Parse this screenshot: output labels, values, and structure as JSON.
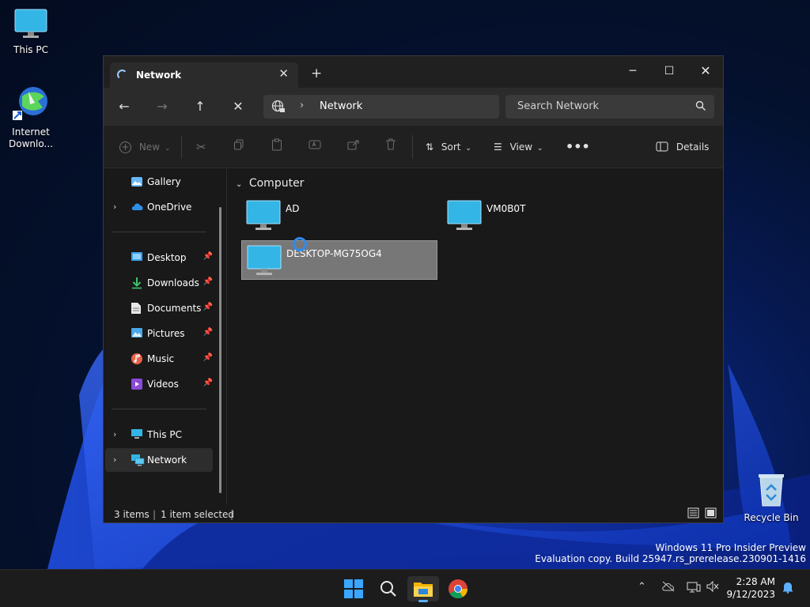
{
  "desktop": {
    "icons": [
      {
        "label": "This PC"
      },
      {
        "label_line1": "Internet",
        "label_line2": "Downlo..."
      },
      {
        "label": "Recycle Bin"
      }
    ]
  },
  "window": {
    "tab_title": "Network",
    "address": {
      "location": "Network"
    },
    "search": {
      "placeholder": "Search Network"
    },
    "toolbar": {
      "new_label": "New",
      "sort_label": "Sort",
      "view_label": "View",
      "details_label": "Details"
    },
    "sidebar": {
      "items": [
        {
          "label": "Gallery"
        },
        {
          "label": "OneDrive"
        },
        {
          "label": "Desktop"
        },
        {
          "label": "Downloads"
        },
        {
          "label": "Documents"
        },
        {
          "label": "Pictures"
        },
        {
          "label": "Music"
        },
        {
          "label": "Videos"
        },
        {
          "label": "This PC"
        },
        {
          "label": "Network"
        }
      ]
    },
    "content": {
      "group": "Computer",
      "items": [
        {
          "name": "AD"
        },
        {
          "name": "VM0B0T"
        },
        {
          "name": "DESKTOP-MG75OG4"
        }
      ]
    },
    "status": {
      "count": "3 items",
      "selected": "1 item selected"
    }
  },
  "watermark": {
    "line1": "Windows 11 Pro Insider Preview",
    "line2": "Evaluation copy. Build 25947.rs_prerelease.230901-1416"
  },
  "taskbar": {
    "time": "2:28 AM",
    "date": "9/12/2023"
  },
  "colors": {
    "accent": "#2d8bf0",
    "window_bg": "#191919",
    "selection": "#777777"
  }
}
